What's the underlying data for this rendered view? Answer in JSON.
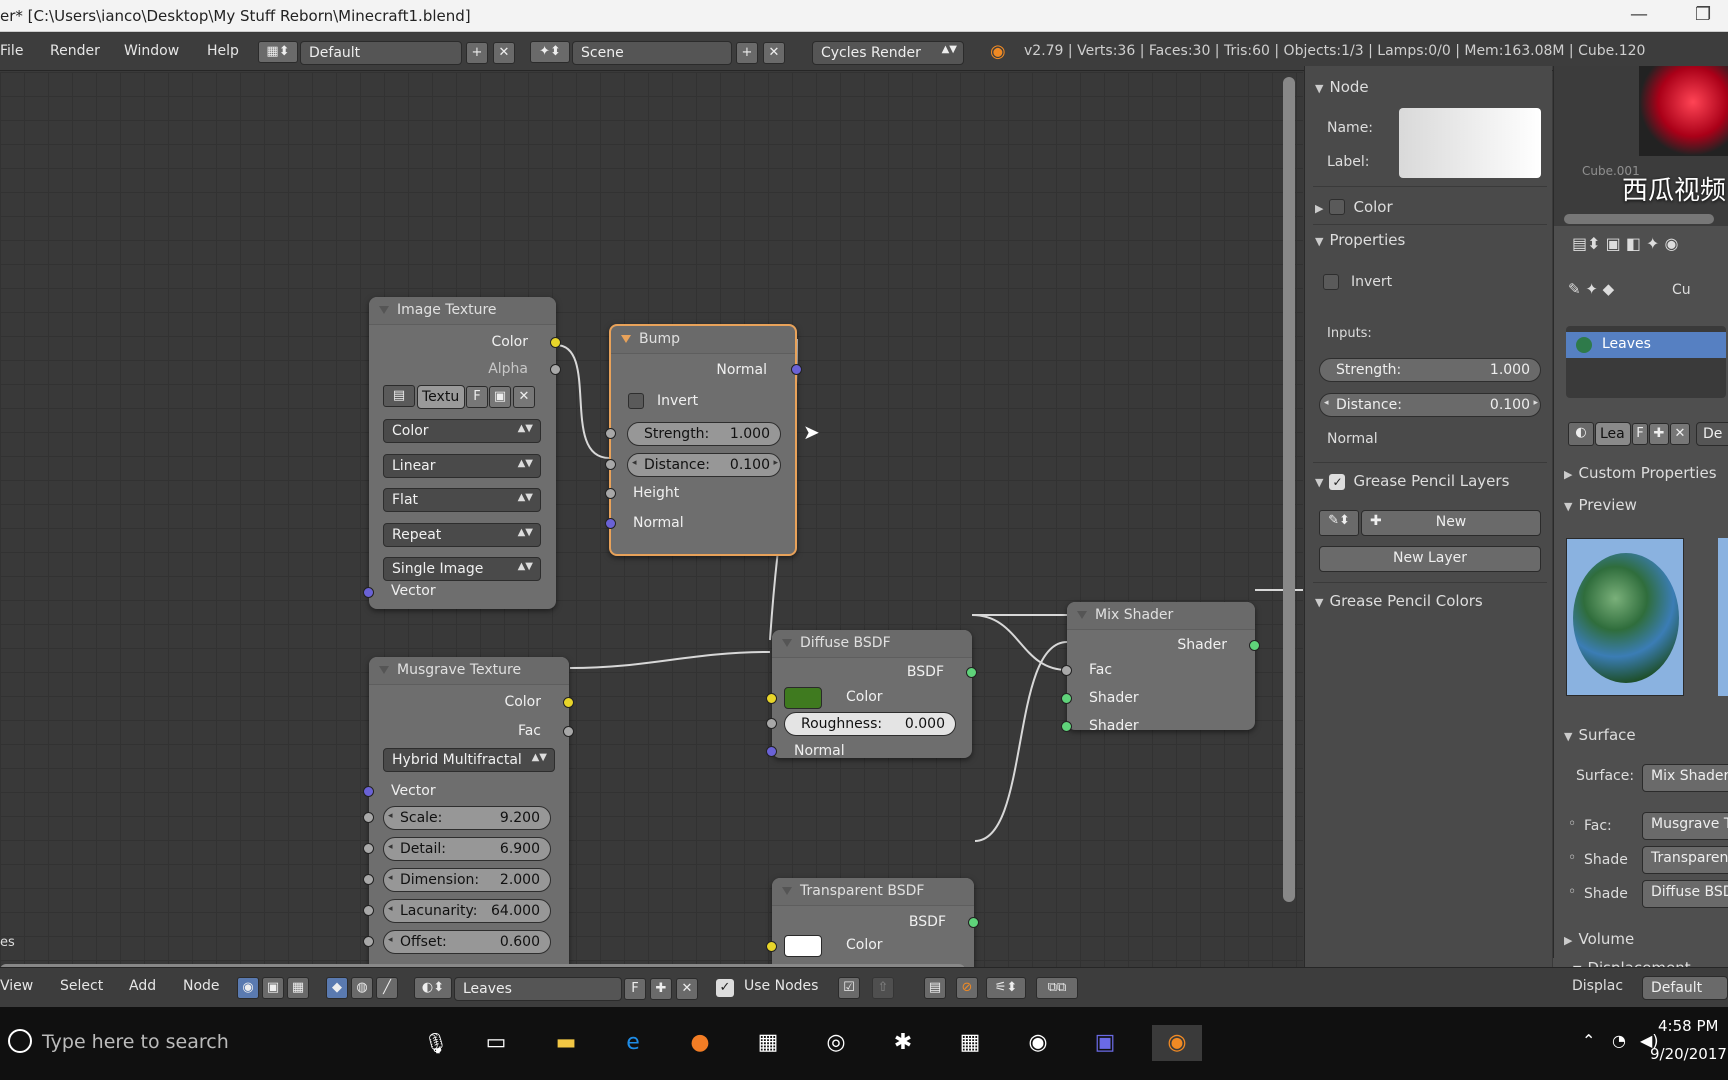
{
  "titlebar": {
    "title": "er* [C:\\Users\\ianco\\Desktop\\My Stuff Reborn\\Minecraft1.blend]",
    "minimize": "—",
    "maximize": "❐"
  },
  "menubar": {
    "items": [
      "File",
      "Render",
      "Window",
      "Help"
    ],
    "layout": "Default",
    "scene": "Scene",
    "engine": "Cycles Render",
    "stats": "v2.79 | Verts:36 | Faces:30 | Tris:60 | Objects:1/3 | Lamps:0/0 | Mem:163.08M | Cube.120"
  },
  "nodes": {
    "image_texture": {
      "title": "Image Texture",
      "out_color": "Color",
      "out_alpha": "Alpha",
      "tex_name": "Textu",
      "tex_f": "F",
      "color_mode": "Color",
      "interpolation": "Linear",
      "projection": "Flat",
      "extension": "Repeat",
      "source": "Single Image",
      "in_vector": "Vector"
    },
    "bump": {
      "title": "Bump",
      "out_normal": "Normal",
      "invert": "Invert",
      "strength_label": "Strength:",
      "strength": "1.000",
      "distance_label": "Distance:",
      "distance": "0.100",
      "in_height": "Height",
      "in_normal": "Normal"
    },
    "musgrave": {
      "title": "Musgrave Texture",
      "out_color": "Color",
      "out_fac": "Fac",
      "type": "Hybrid Multifractal",
      "in_vector": "Vector",
      "scale_label": "Scale:",
      "scale": "9.200",
      "detail_label": "Detail:",
      "detail": "6.900",
      "dimension_label": "Dimension:",
      "dimension": "2.000",
      "lacunarity_label": "Lacunarity:",
      "lacunarity": "64.000",
      "offset_label": "Offset:",
      "offset": "0.600"
    },
    "diffuse": {
      "title": "Diffuse BSDF",
      "out_bsdf": "BSDF",
      "in_color": "Color",
      "roughness_label": "Roughness:",
      "roughness": "0.000",
      "in_normal": "Normal",
      "color_swatch": "#3f7a1f"
    },
    "mix": {
      "title": "Mix Shader",
      "out_shader": "Shader",
      "in_fac": "Fac",
      "in_shader1": "Shader",
      "in_shader2": "Shader"
    },
    "transparent": {
      "title": "Transparent BSDF",
      "out_bsdf": "BSDF",
      "in_color": "Color",
      "color_swatch": "#ffffff"
    }
  },
  "editor_left_label": "es",
  "props": {
    "node_header": "Node",
    "name_label": "Name:",
    "label_label": "Label:",
    "color_header": "Color",
    "properties_header": "Properties",
    "invert": "Invert",
    "inputs_label": "Inputs:",
    "strength_label": "Strength:",
    "strength": "1.000",
    "distance_label": "Distance:",
    "distance": "0.100",
    "normal_label": "Normal",
    "gp_layers_header": "Grease Pencil Layers",
    "new_btn": "New",
    "new_layer_btn": "New Layer",
    "gp_colors_header": "Grease Pencil Colors"
  },
  "rpanel": {
    "watermark": "西瓜视频",
    "outliner_item": "Cube.001",
    "obj_name": "Cu",
    "material": "Leaves",
    "mat_name": "Lea",
    "mat_f": "F",
    "mat_de": "De",
    "custom_props": "Custom Properties",
    "preview": "Preview",
    "surface_header": "Surface",
    "surface_label": "Surface:",
    "surface_value": "Mix Shader",
    "fac_label": "Fac:",
    "fac_value": "Musgrave T",
    "shader1_label": "Shade",
    "shader1_value": "Transparen",
    "shader2_label": "Shade",
    "shader2_value": "Diffuse BSD",
    "volume": "Volume",
    "displacement": "Displacement",
    "displac_label": "Displac",
    "displac_value": "Default"
  },
  "bottombar": {
    "view": "View",
    "select": "Select",
    "add": "Add",
    "node": "Node",
    "material": "Leaves",
    "mat_f": "F",
    "use_nodes": "Use Nodes"
  },
  "taskbar": {
    "search": "Type here to search",
    "time": "4:58 PM",
    "date": "9/20/2017"
  }
}
